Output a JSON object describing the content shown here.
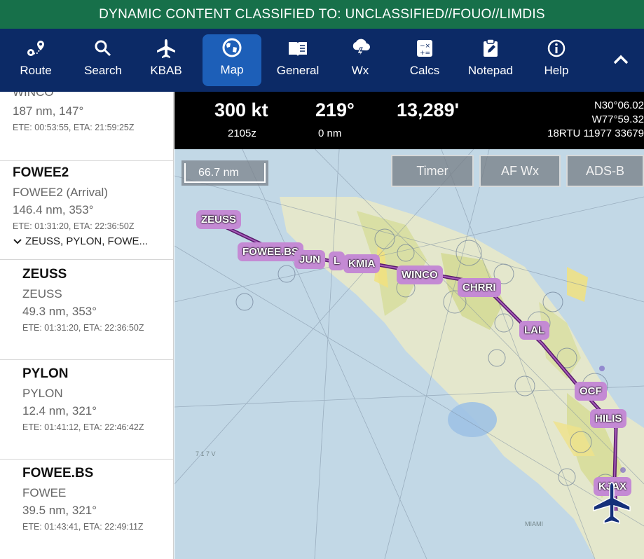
{
  "banner": {
    "text": "DYNAMIC CONTENT CLASSIFIED TO: UNCLASSIFIED//FOUO//LIMDIS",
    "color": "#17704a"
  },
  "nav": {
    "items": [
      {
        "label": "Route",
        "icon": "route-icon"
      },
      {
        "label": "Search",
        "icon": "search-icon"
      },
      {
        "label": "KBAB",
        "icon": "airplane-icon"
      },
      {
        "label": "Map",
        "icon": "globe-icon",
        "active": true
      },
      {
        "label": "General",
        "icon": "book-icon"
      },
      {
        "label": "Wx",
        "icon": "weather-icon"
      },
      {
        "label": "Calcs",
        "icon": "calculator-icon"
      },
      {
        "label": "Notepad",
        "icon": "notepad-icon"
      },
      {
        "label": "Help",
        "icon": "info-icon"
      }
    ],
    "background": "#0c2a66",
    "active_color": "#1d5fb8"
  },
  "sidebar": {
    "partial_top": "WINCO",
    "entries": [
      {
        "title": "",
        "dist": "187 nm, 147°",
        "ete": "ETE: 00:53:55, ETA: 21:59:25Z"
      },
      {
        "title": "FOWEE2",
        "sub": "FOWEE2 (Arrival)",
        "dist": "146.4 nm, 353°",
        "ete": "ETE: 01:31:20, ETA: 22:36:50Z",
        "expander": "ZEUSS, PYLON, FOWE..."
      },
      {
        "title": "ZEUSS",
        "sub": "ZEUSS",
        "dist": "49.3 nm, 353°",
        "ete": "ETE: 01:31:20, ETA: 22:36:50Z"
      },
      {
        "title": "PYLON",
        "sub": "PYLON",
        "dist": "12.4 nm, 321°",
        "ete": "ETE: 01:41:12, ETA: 22:46:42Z"
      },
      {
        "title": "FOWEE.BS",
        "sub": "FOWEE",
        "dist": "39.5 nm, 321°",
        "ete": "ETE: 01:43:41, ETA: 22:49:11Z"
      }
    ]
  },
  "status": {
    "speed": "300 kt",
    "time": "2105z",
    "heading": "219°",
    "distance": "0 nm",
    "altitude": "13,289'",
    "lat": "N30°06.02",
    "lon": "W77°59.32",
    "mgrs": "18RTU 11977 33679"
  },
  "map": {
    "scale": "66.7 nm",
    "buttons": [
      "Timer",
      "AF Wx",
      "ADS-B"
    ],
    "waypoints": [
      "ZEUSS",
      "FOWEE.BS",
      "JUN",
      "L",
      "KMIA",
      "WINCO",
      "CHRRI",
      "LAL",
      "OCF",
      "HILIS",
      "KJAX"
    ],
    "route_color": "#6a1f7d",
    "waypoint_color": "#c48ad4",
    "aircraft_color": "#15307a"
  }
}
